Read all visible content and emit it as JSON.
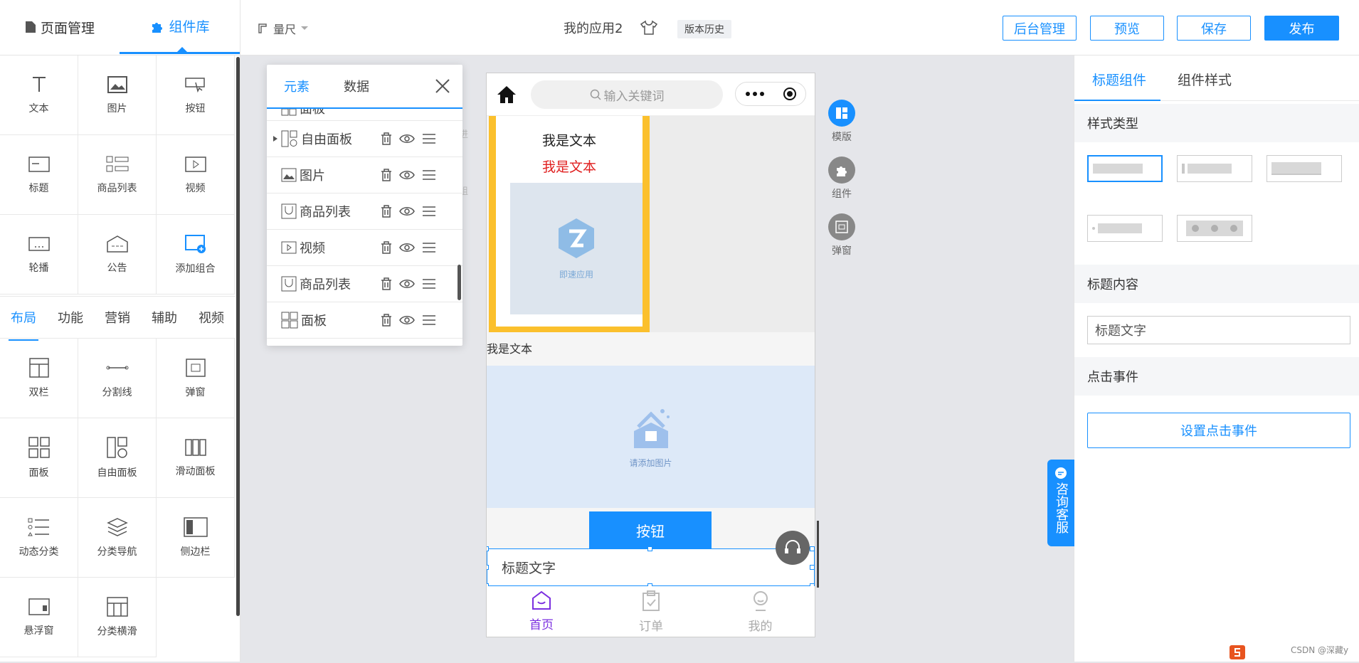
{
  "topbar": {
    "tabs": [
      {
        "label": "页面管理"
      },
      {
        "label": "组件库"
      }
    ],
    "ruler": "量尺",
    "app_name": "我的应用2",
    "version_history": "版本历史",
    "buttons": {
      "admin": "后台管理",
      "preview": "预览",
      "save": "保存",
      "publish": "发布"
    }
  },
  "basic_components": [
    {
      "label": "文本",
      "icon": "text-icon"
    },
    {
      "label": "图片",
      "icon": "image-icon"
    },
    {
      "label": "按钮",
      "icon": "button-icon"
    },
    {
      "label": "标题",
      "icon": "title-icon"
    },
    {
      "label": "商品列表",
      "icon": "product-list-icon"
    },
    {
      "label": "视频",
      "icon": "video-icon"
    },
    {
      "label": "轮播",
      "icon": "carousel-icon"
    },
    {
      "label": "公告",
      "icon": "notice-icon"
    },
    {
      "label": "添加组合",
      "icon": "add-group-icon"
    }
  ],
  "categories": [
    "布局",
    "功能",
    "营销",
    "辅助",
    "视频"
  ],
  "layout_components": [
    {
      "label": "双栏",
      "icon": "two-column-icon"
    },
    {
      "label": "分割线",
      "icon": "divider-icon"
    },
    {
      "label": "弹窗",
      "icon": "popup-icon"
    },
    {
      "label": "面板",
      "icon": "panel-icon"
    },
    {
      "label": "自由面板",
      "icon": "free-panel-icon"
    },
    {
      "label": "滑动面板",
      "icon": "slide-panel-icon"
    },
    {
      "label": "动态分类",
      "icon": "dynamic-category-icon"
    },
    {
      "label": "分类导航",
      "icon": "category-nav-icon"
    },
    {
      "label": "侧边栏",
      "icon": "sidebar-icon"
    },
    {
      "label": "悬浮窗",
      "icon": "float-window-icon"
    },
    {
      "label": "分类横滑",
      "icon": "category-scroll-icon"
    }
  ],
  "element_panel": {
    "tabs": [
      "元素",
      "数据"
    ],
    "partial_row": "面板",
    "rows": [
      {
        "label": "自由面板",
        "icon": "free-panel-icon"
      },
      {
        "label": "图片",
        "icon": "image-icon"
      },
      {
        "label": "商品列表",
        "icon": "product-list-icon"
      },
      {
        "label": "视频",
        "icon": "video-icon"
      },
      {
        "label": "商品列表",
        "icon": "product-list-icon"
      },
      {
        "label": "面板",
        "icon": "panel-icon"
      }
    ]
  },
  "phone": {
    "search_placeholder": "输入关键词",
    "text1": "我是文本",
    "text2": "我是文本",
    "logo_caption": "即速应用",
    "text3": "我是文本",
    "add_image": "请添加图片",
    "button": "按钮",
    "title_text": "标题文字",
    "tabbar": [
      {
        "label": "首页"
      },
      {
        "label": "订单"
      },
      {
        "label": "我的"
      }
    ],
    "ghost_left": [
      "进",
      "组"
    ]
  },
  "side_tools": [
    {
      "label": "模版"
    },
    {
      "label": "组件"
    },
    {
      "label": "弹窗"
    }
  ],
  "right_panel": {
    "tabs": [
      "标题组件",
      "组件样式"
    ],
    "style_type": "样式类型",
    "title_content": "标题内容",
    "title_value": "标题文字",
    "click_event": "点击事件",
    "set_click": "设置点击事件"
  },
  "consult": "咨询客服",
  "watermark": "CSDN @深藏y",
  "colors": {
    "accent": "#1890ff",
    "highlight": "#fbc02d",
    "red": "#e02020",
    "purple": "#7b2fe0"
  }
}
